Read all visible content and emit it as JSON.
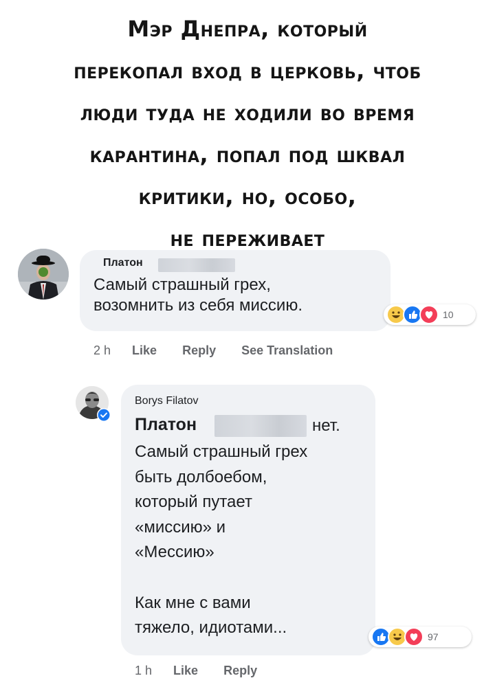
{
  "headline": {
    "lines": [
      "Мэр Днепра, который",
      "перекопал вход в церковь, чтоб",
      "люди туда не ходили во время",
      "карантина, попал под шквал",
      "критики, но, особо,",
      "не переживает"
    ]
  },
  "comment_1": {
    "author": "Платон",
    "text": "Самый страшный грех,\nвозомнить из себя миссию.",
    "reaction_icons": [
      "haha-icon",
      "like-icon",
      "love-icon"
    ],
    "reaction_count": "10",
    "time": "2 h",
    "like_label": "Like",
    "reply_label": "Reply",
    "translate_label": "See Translation"
  },
  "comment_2": {
    "author": "Borys Filatov",
    "mention": "Платон",
    "mention_tail": "нет.",
    "text": "Самый страшный грех\nбыть долбоебом,\nкоторый путает\n«миссию» и\n«Мессию»\n\nКак мне с вами\nтяжело, идиотами...",
    "reaction_icons": [
      "like-icon",
      "haha-icon",
      "love-icon"
    ],
    "reaction_count": "97",
    "time": "1 h",
    "like_label": "Like",
    "reply_label": "Reply"
  },
  "colors": {
    "bubble": "#f0f2f5",
    "meta_text": "#65676b",
    "like_blue": "#1877f2",
    "love_red": "#f33e58",
    "haha_yellow": "#f7c94a"
  }
}
